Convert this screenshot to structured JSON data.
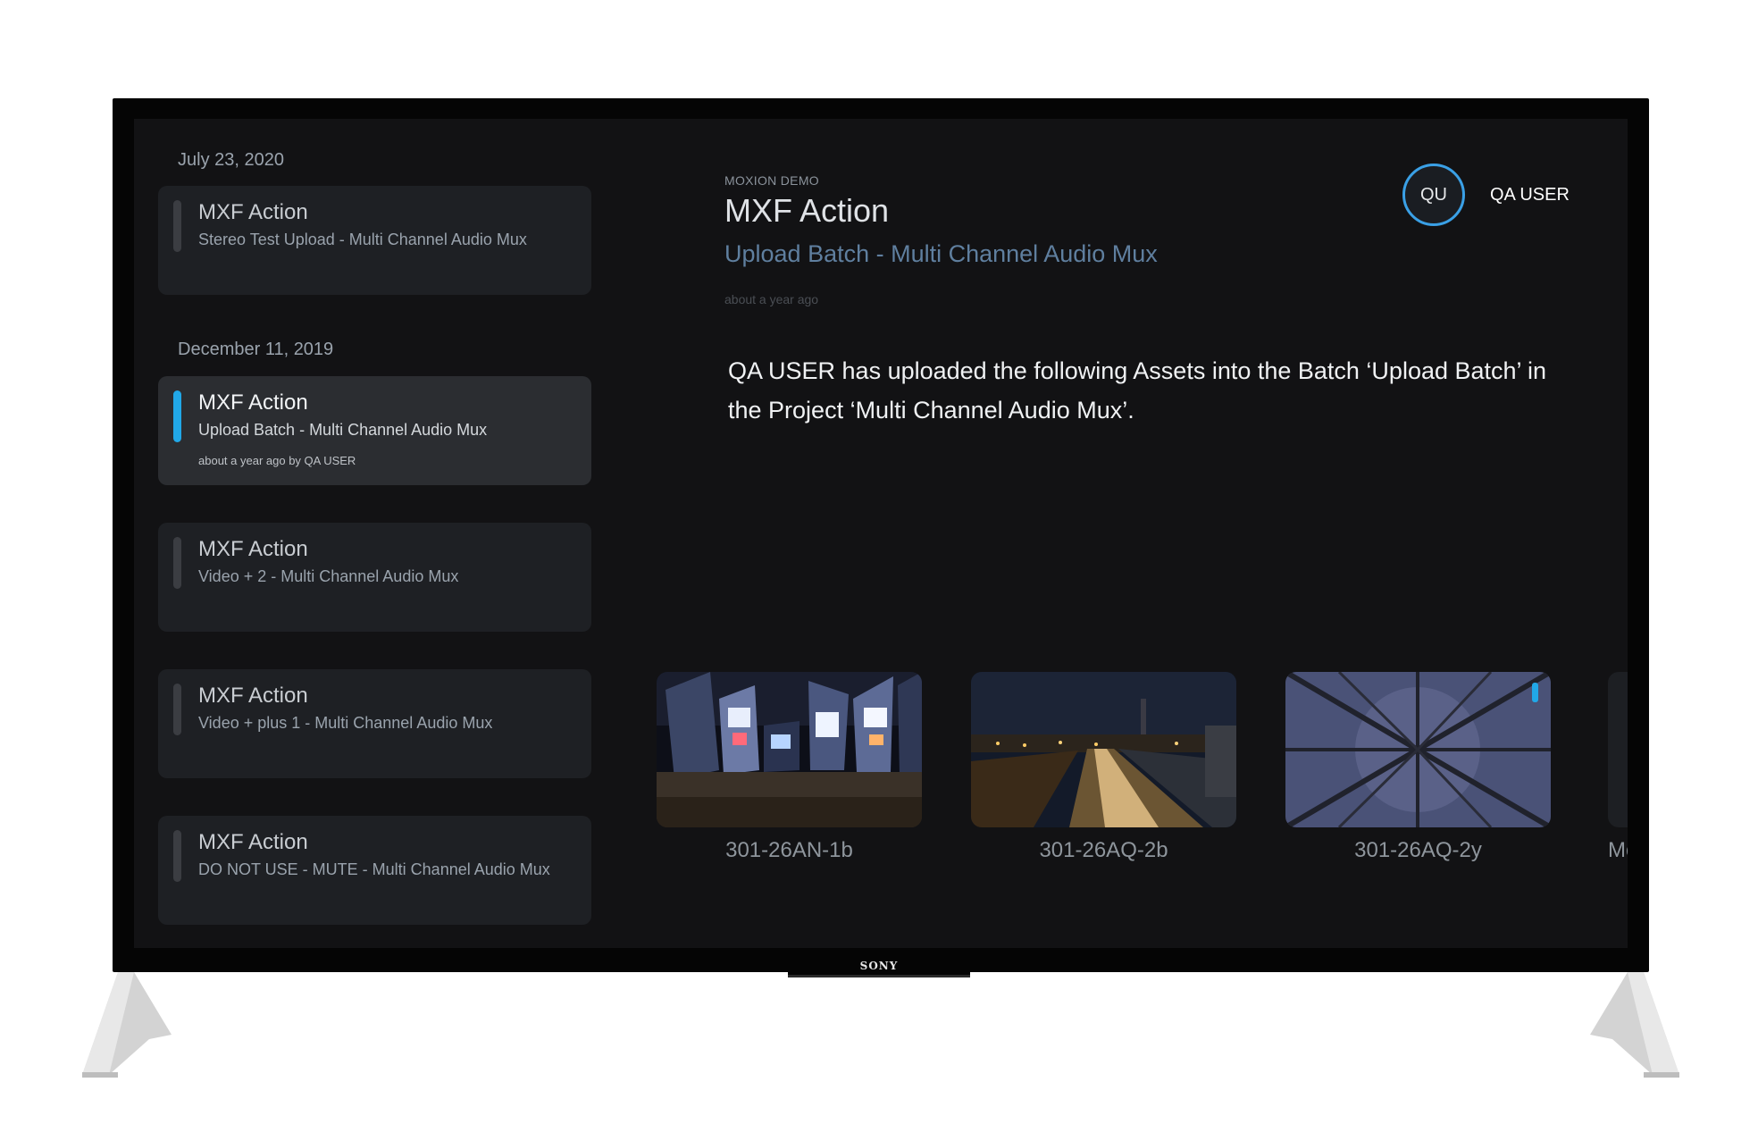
{
  "device": {
    "brand": "SONY"
  },
  "sidebar": {
    "groups": [
      {
        "date": "July 23, 2020",
        "items": [
          {
            "title": "MXF Action",
            "subtitle": "Stereo Test Upload - Multi Channel Audio Mux",
            "meta": ""
          }
        ]
      },
      {
        "date": "December 11, 2019",
        "items": [
          {
            "title": "MXF Action",
            "subtitle": "Upload Batch - Multi Channel Audio Mux",
            "meta": "about a year ago by QA USER"
          },
          {
            "title": "MXF Action",
            "subtitle": "Video + 2 - Multi Channel Audio Mux",
            "meta": ""
          },
          {
            "title": "MXF Action",
            "subtitle": "Video + plus 1 - Multi Channel Audio Mux",
            "meta": ""
          },
          {
            "title": "MXF Action",
            "subtitle": "DO NOT USE - MUTE - Multi Channel Audio Mux",
            "meta": ""
          }
        ]
      }
    ]
  },
  "detail": {
    "project": "MOXION DEMO",
    "title": "MXF Action",
    "subtitle": "Upload Batch - Multi Channel Audio Mux",
    "time": "about a year ago",
    "description": "QA USER has uploaded the following Assets into the Batch ‘Upload Batch’ in the Project ‘Multi Channel Audio Mux’.",
    "assets": [
      {
        "name": "301-26AN-1b",
        "thumb": "city-crowd-night"
      },
      {
        "name": "301-26AQ-2b",
        "thumb": "train-tracks-night"
      },
      {
        "name": "301-26AQ-2y",
        "thumb": "forest-canopy"
      },
      {
        "name": "Mc",
        "thumb": ""
      }
    ]
  },
  "user": {
    "initials": "QU",
    "name": "QA USER"
  },
  "colors": {
    "accent": "#21a8e8",
    "avatar_ring": "#3aa0e6",
    "background": "#121214"
  }
}
